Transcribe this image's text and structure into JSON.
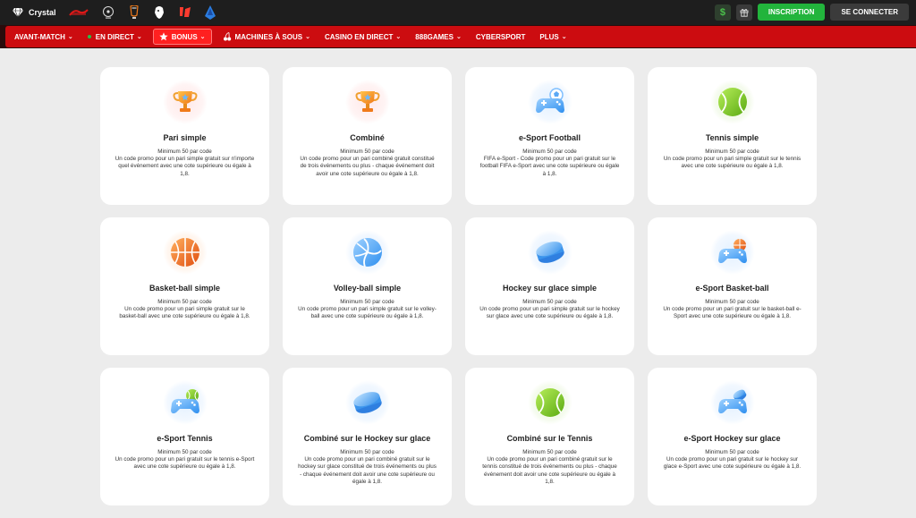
{
  "topbar": {
    "crystal_label": "Crystal",
    "signup_label": "INSCRIPTION",
    "login_label": "SE CONNECTER",
    "dollar_symbol": "$"
  },
  "nav": {
    "items": [
      {
        "label": "AVANT-MATCH"
      },
      {
        "label": "EN DIRECT"
      },
      {
        "label": "BONUS"
      },
      {
        "label": "MACHINES À SOUS"
      },
      {
        "label": "CASINO EN DIRECT"
      },
      {
        "label": "888GAMES"
      },
      {
        "label": "CYBERSPORT"
      },
      {
        "label": "PLUS"
      }
    ]
  },
  "cards": [
    {
      "title": "Pari simple",
      "min": "Minimum 50 par code",
      "desc": "Un code promo pour un pari simple gratuit sur n'importe quel événement avec une cote supérieure ou égale à 1,8.",
      "icon": "trophy-icon"
    },
    {
      "title": "Combiné",
      "min": "Minimum 50 par code",
      "desc": "Un code promo pour un pari combiné gratuit constitué de trois événements ou plus - chaque événement doit avoir une cote supérieure ou égale à 1,8.",
      "icon": "trophy-icon"
    },
    {
      "title": "e-Sport Football",
      "min": "Minimum 50 par code",
      "desc": "FIFA e-Sport - Code promo pour un pari gratuit sur le football FIFA e-Sport avec une cote supérieure ou égale à 1,8.",
      "icon": "gamepad-football-icon"
    },
    {
      "title": "Tennis simple",
      "min": "Minimum 50 par code",
      "desc": "Un code promo pour un pari simple gratuit sur le tennis avec une cote supérieure ou égale à 1,8.",
      "icon": "tennis-ball-icon"
    },
    {
      "title": "Basket-ball simple",
      "min": "Minimum 50 par code",
      "desc": "Un code promo pour un pari simple gratuit sur le basket-ball avec une cote supérieure ou égale à 1,8.",
      "icon": "basketball-icon"
    },
    {
      "title": "Volley-ball simple",
      "min": "Minimum 50 par code",
      "desc": "Un code promo pour un pari simple gratuit sur le volley-ball avec une cote supérieure ou égale à 1,8.",
      "icon": "volleyball-icon"
    },
    {
      "title": "Hockey sur glace simple",
      "min": "Minimum 50 par code",
      "desc": "Un code promo pour un pari simple gratuit sur le hockey sur glace avec une cote supérieure ou égale à 1,8.",
      "icon": "hockey-puck-icon"
    },
    {
      "title": "e-Sport Basket-ball",
      "min": "Minimum 50 par code",
      "desc": "Un code promo pour un pari gratuit sur le basket-ball e-Sport avec une cote supérieure ou égale à 1,8.",
      "icon": "gamepad-basketball-icon"
    },
    {
      "title": "e-Sport Tennis",
      "min": "Minimum 50 par code",
      "desc": "Un code promo pour un pari gratuit sur le tennis e-Sport avec une cote supérieure ou égale à 1,8.",
      "icon": "gamepad-tennis-icon"
    },
    {
      "title": "Combiné sur le Hockey sur glace",
      "min": "Minimum 50 par code",
      "desc": "Un code promo pour un pari combiné gratuit sur le hockey sur glace constitué de trois événements ou plus - chaque événement doit avoir une cote supérieure ou égale à 1,8.",
      "icon": "hockey-puck-icon"
    },
    {
      "title": "Combiné sur le Tennis",
      "min": "Minimum 50 par code",
      "desc": "Un code promo pour un pari combiné gratuit sur le tennis constitué de trois événements ou plus - chaque événement doit avoir une cote supérieure ou égale à 1,8.",
      "icon": "tennis-ball-icon"
    },
    {
      "title": "e-Sport Hockey sur glace",
      "min": "Minimum 50 par code",
      "desc": "Un code promo pour un pari gratuit sur le hockey sur glace e-Sport avec une cote supérieure ou égale à 1,8.",
      "icon": "gamepad-hockey-icon"
    }
  ],
  "colors": {
    "nav_red": "#cc0c10",
    "active_red": "#ff2020",
    "signup_green": "#22b43c",
    "topbar_bg": "#1e1e1e",
    "page_bg": "#ececec"
  }
}
